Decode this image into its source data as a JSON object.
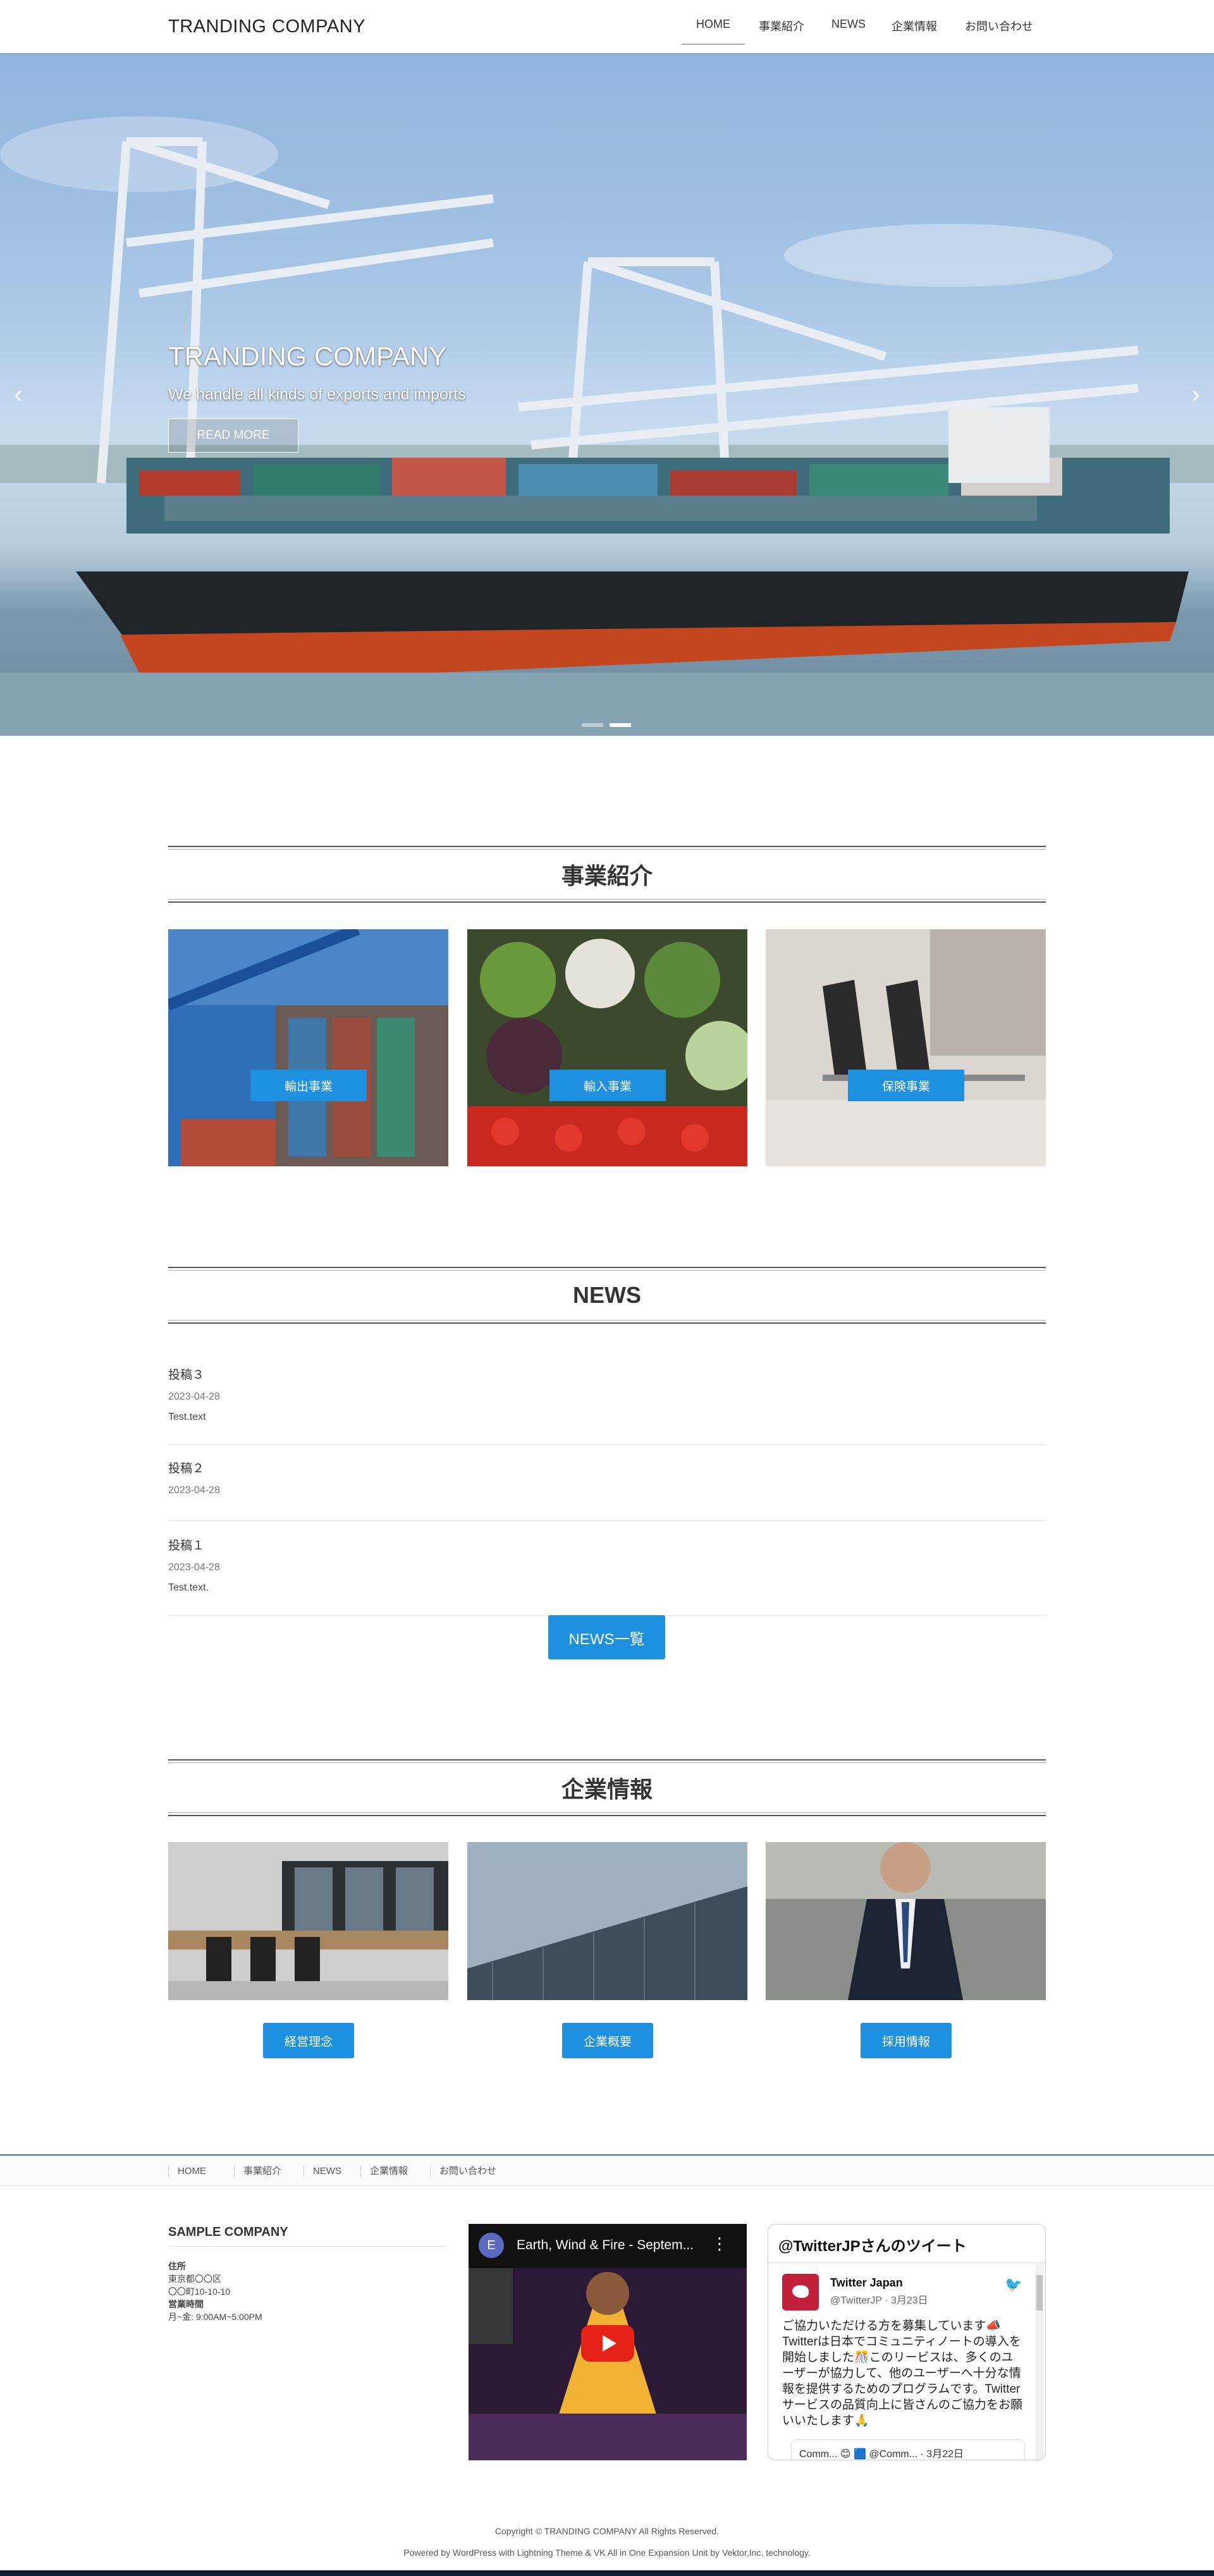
{
  "header": {
    "logo": "TRANDING COMPANY",
    "nav": [
      "HOME",
      "事業紹介",
      "NEWS",
      "企業情報",
      "お問い合わせ"
    ]
  },
  "hero": {
    "title": "TRANDING COMPANY",
    "subtitle": "We handle all kinds of exports and imports",
    "button": "READ MORE",
    "prev_icon": "chevron-left-icon",
    "next_icon": "chevron-right-icon",
    "slides": 2,
    "active_slide": 2
  },
  "business": {
    "heading": "事業紹介",
    "cards": [
      {
        "label": "輸出事業"
      },
      {
        "label": "輸入事業"
      },
      {
        "label": "保険事業"
      }
    ]
  },
  "news": {
    "heading": "NEWS",
    "items": [
      {
        "title": "投稿３",
        "date": "2023-04-28",
        "excerpt": "Test.text"
      },
      {
        "title": "投稿２",
        "date": "2023-04-28",
        "excerpt": ""
      },
      {
        "title": "投稿１",
        "date": "2023-04-28",
        "excerpt": "Test.text."
      }
    ],
    "all_button": "NEWS一覧"
  },
  "company": {
    "heading": "企業情報",
    "buttons": [
      "経営理念",
      "企業概要",
      "採用情報"
    ]
  },
  "footer_nav": [
    "HOME",
    "事業紹介",
    "NEWS",
    "企業情報",
    "お問い合わせ"
  ],
  "footer": {
    "company_name": "SAMPLE COMPANY",
    "address_label": "住所",
    "address_line1": "東京都〇〇区",
    "address_line2": "〇〇町10-10-10",
    "hours_label": "営業時間",
    "hours": "月~金: 9:00AM~5:00PM",
    "video": {
      "avatar_letter": "E",
      "title": "Earth, Wind & Fire - Septem...",
      "menu_icon": "more-vertical-icon",
      "play_icon": "youtube-play-icon"
    },
    "twitter": {
      "heading": "@TwitterJPさんのツイート",
      "name": "Twitter Japan",
      "handle": "@TwitterJP · 3月23日",
      "bird_icon": "twitter-bird-icon",
      "text": "ご協力いただける方を募集しています📣 Twitterは日本でコミュニティノートの導入を開始しました🎊このリービスは、多くのユーザーが協力して、他のユーザーへ十分な情報を提供するためのプログラムです。Twitterサービスの品質向上に皆さんのご協力をお願いいたします🙏",
      "sub": "Comm... 😊 🟦 @Comm... · 3月22日"
    },
    "copyright": "Copyright © TRANDING COMPANY All Rights Reserved.",
    "powered": "Powered by WordPress with Lightning Theme & VK All in One Expansion Unit by Vektor,Inc. technology."
  },
  "colors": {
    "accent": "#1e90e0",
    "footer_border": "#3a6fb0",
    "bottom_bar": "#0f1f33"
  }
}
